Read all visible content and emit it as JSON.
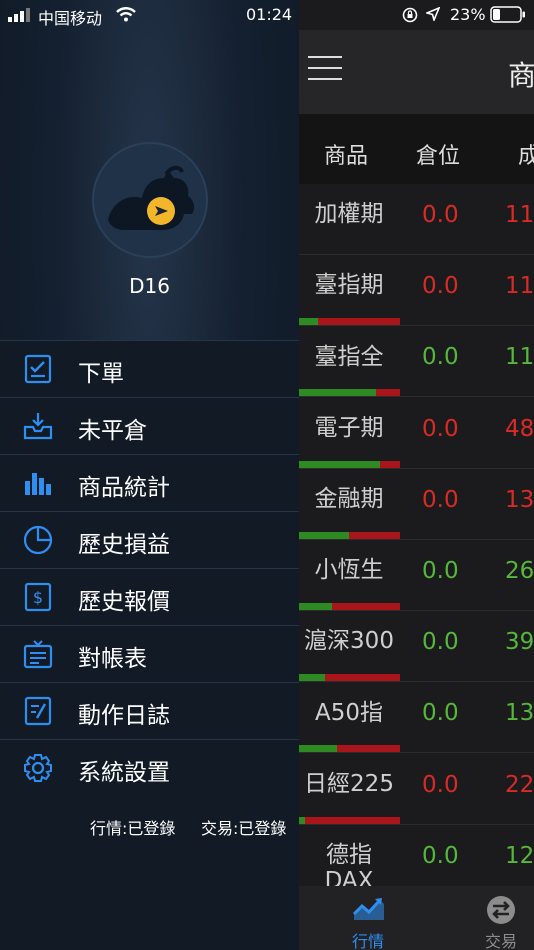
{
  "status_bar": {
    "carrier": "中国移动",
    "time": "01:24",
    "battery": "23%"
  },
  "main": {
    "title": "商",
    "columns": [
      "商品",
      "倉位",
      "成"
    ],
    "rows": [
      {
        "name": "加權期",
        "position": "0.0",
        "price": "11",
        "pos_color": "red",
        "price_color": "red",
        "bar": null
      },
      {
        "name": "臺指期",
        "position": "0.0",
        "price": "11",
        "pos_color": "red",
        "price_color": "red",
        "bar": 0.2
      },
      {
        "name": "臺指全",
        "position": "0.0",
        "price": "11",
        "pos_color": "green",
        "price_color": "green",
        "bar": 0.76
      },
      {
        "name": "電子期",
        "position": "0.0",
        "price": "48",
        "pos_color": "red",
        "price_color": "red",
        "bar": 0.8
      },
      {
        "name": "金融期",
        "position": "0.0",
        "price": "13",
        "pos_color": "red",
        "price_color": "red",
        "bar": 0.5
      },
      {
        "name": "小恆生",
        "position": "0.0",
        "price": "26",
        "pos_color": "green",
        "price_color": "green",
        "bar": 0.33
      },
      {
        "name": "滬深300",
        "position": "0.0",
        "price": "39",
        "pos_color": "green",
        "price_color": "green",
        "bar": 0.26
      },
      {
        "name": "A50指",
        "position": "0.0",
        "price": "13",
        "pos_color": "green",
        "price_color": "green",
        "bar": 0.38
      },
      {
        "name": "日經225",
        "position": "0.0",
        "price": "22",
        "pos_color": "red",
        "price_color": "red",
        "bar": 0.07
      },
      {
        "name": "德指\nDAX",
        "position": "0.0",
        "price": "12",
        "pos_color": "green",
        "price_color": "green",
        "bar": null
      }
    ],
    "tabs": [
      {
        "label": "行情",
        "icon": "chart-trend-icon",
        "active": true
      },
      {
        "label": "交易",
        "icon": "swap-icon",
        "active": false
      }
    ]
  },
  "drawer": {
    "username": "D16",
    "menu": [
      {
        "label": "下單",
        "icon": "checklist-icon"
      },
      {
        "label": "未平倉",
        "icon": "inbox-download-icon"
      },
      {
        "label": "商品統計",
        "icon": "bar-chart-icon"
      },
      {
        "label": "歷史損益",
        "icon": "pie-chart-icon"
      },
      {
        "label": "歷史報價",
        "icon": "dollar-document-icon"
      },
      {
        "label": "對帳表",
        "icon": "statement-icon"
      },
      {
        "label": "動作日誌",
        "icon": "log-edit-icon"
      },
      {
        "label": "系統設置",
        "icon": "gear-icon"
      }
    ],
    "status_quote": "行情:已登錄",
    "status_trade": "交易:已登錄"
  },
  "colors": {
    "accent": "#2f8ff0",
    "red": "#d82b26",
    "green": "#55b83a",
    "gold": "#f1b62a"
  }
}
